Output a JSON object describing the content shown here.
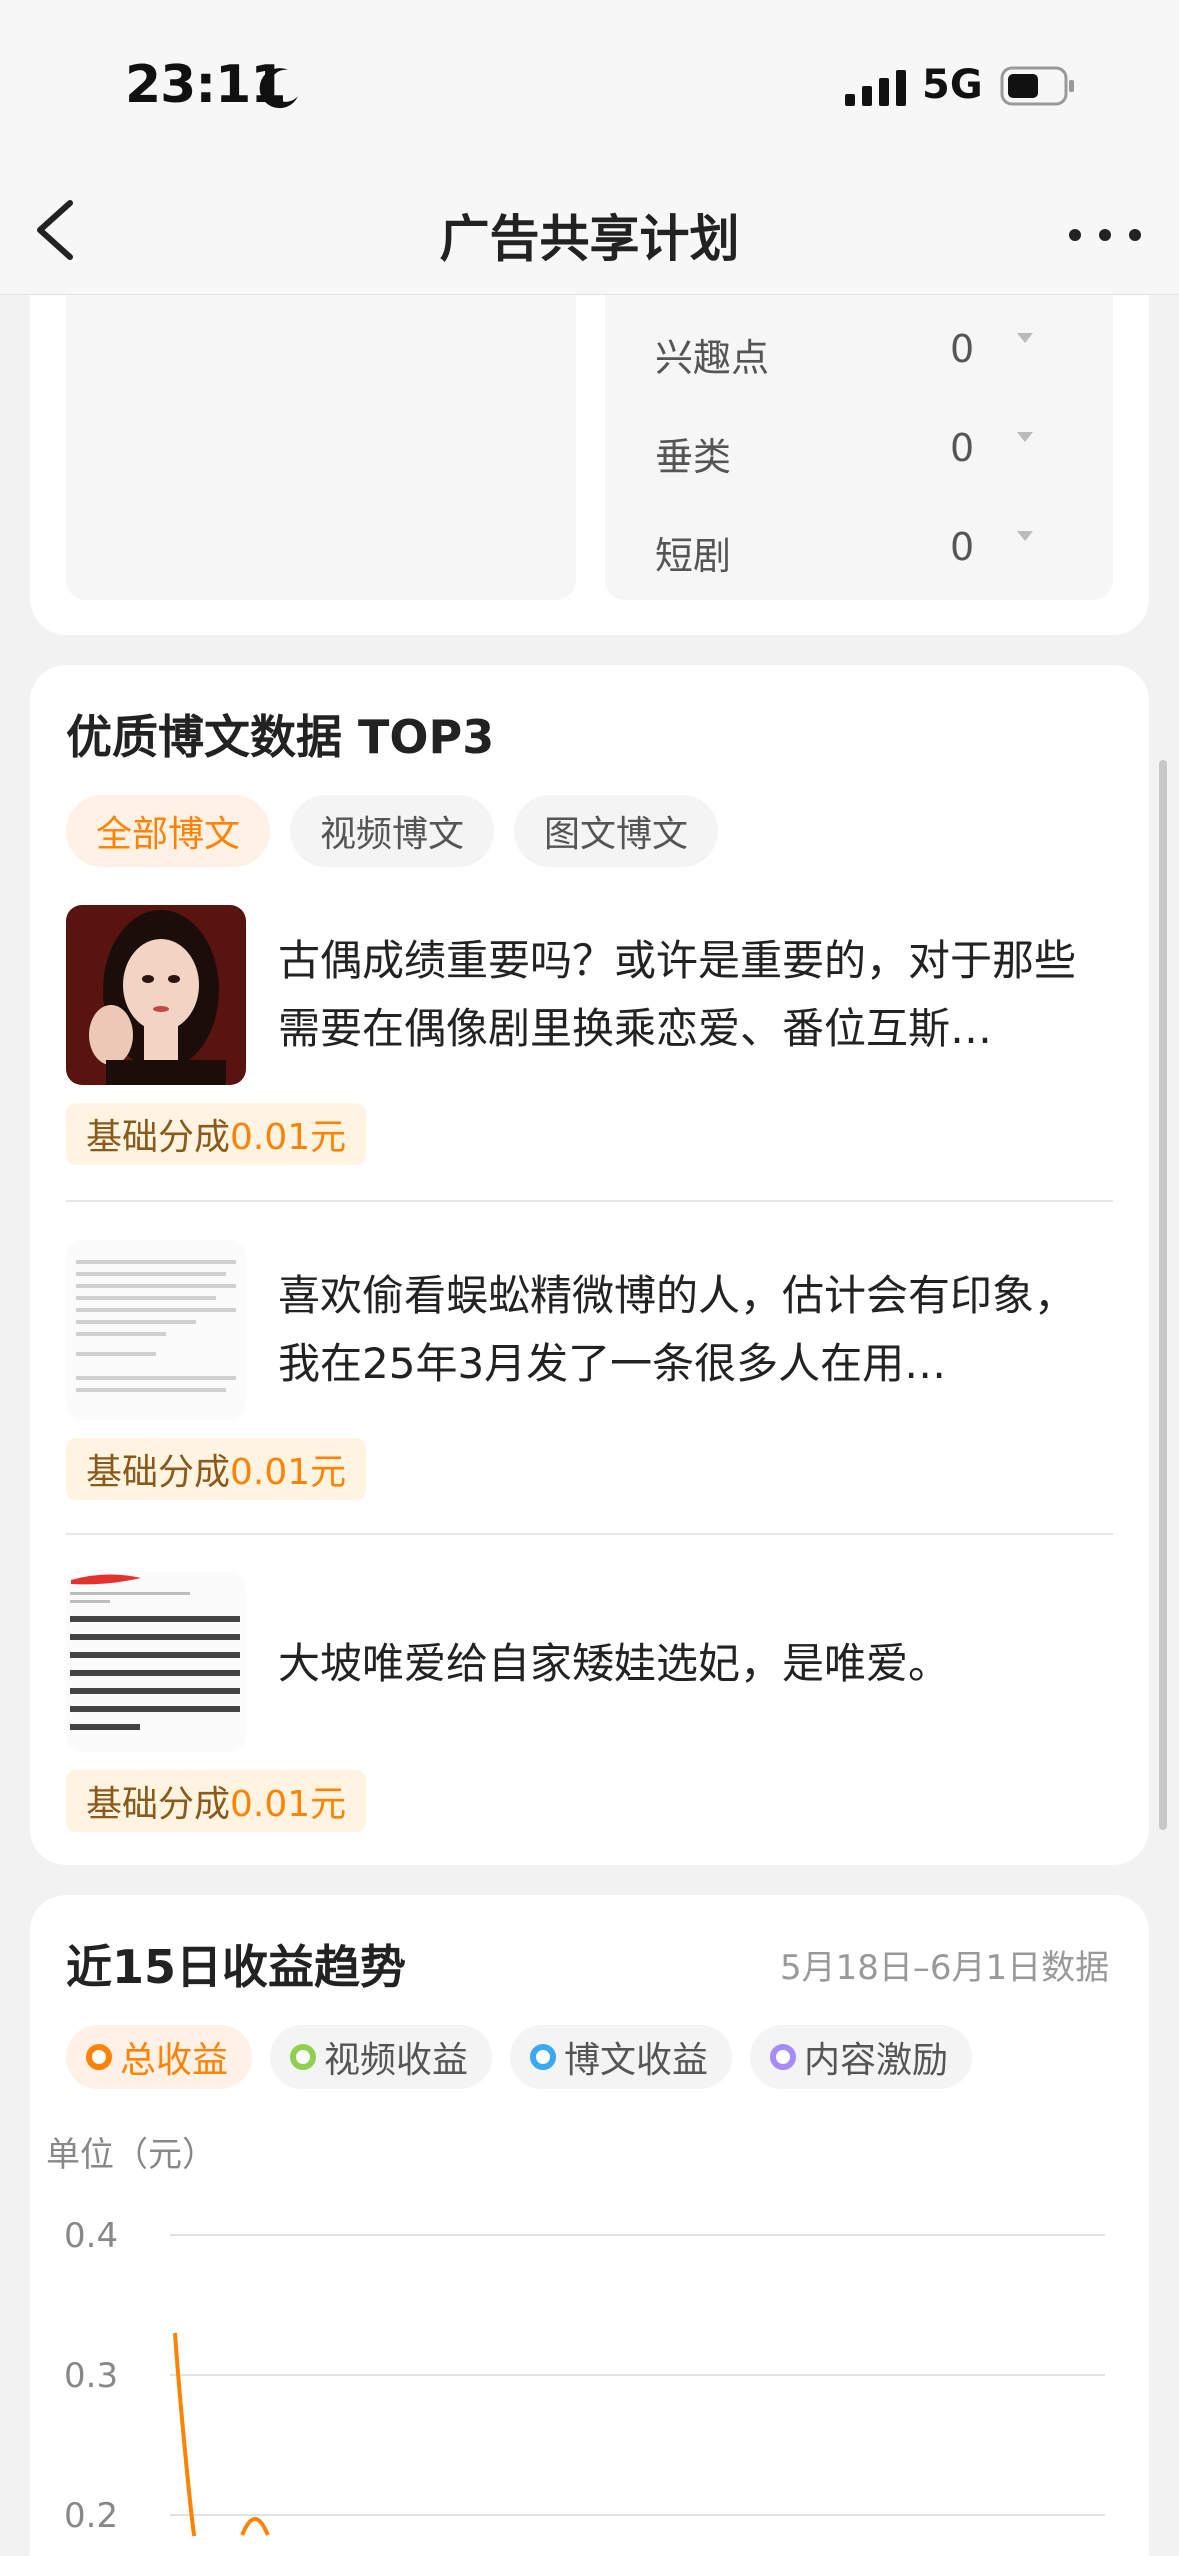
{
  "status_bar": {
    "time": "23:11",
    "network": "5G"
  },
  "nav": {
    "title": "广告共享计划"
  },
  "filters": [
    {
      "label": "兴趣点",
      "value": "0"
    },
    {
      "label": "垂类",
      "value": "0"
    },
    {
      "label": "短剧",
      "value": "0"
    }
  ],
  "top3": {
    "title": "优质博文数据 TOP3",
    "tabs": [
      "全部博文",
      "视频博文",
      "图文博文"
    ],
    "posts": [
      {
        "text": "古偶成绩重要吗？或许是重要的，对于那些需要在偶像剧里换乘恋爱、番位互斯…",
        "badge_label": "基础分成",
        "badge_amount": "0.01元"
      },
      {
        "text": "喜欢偷看蜈蚣精微博的人，估计会有印象，我在25年3月发了一条很多人在用…",
        "badge_label": "基础分成",
        "badge_amount": "0.01元"
      },
      {
        "text": "大坡唯爱给自家矮娃选妃，是唯爱。",
        "badge_label": "基础分成",
        "badge_amount": "0.01元"
      }
    ]
  },
  "trend": {
    "title": "近15日收益趋势",
    "date_range": "5月18日–6月1日数据",
    "legend": [
      {
        "label": "总收益",
        "color": "#ff8200"
      },
      {
        "label": "视频收益",
        "color": "#8fd14f"
      },
      {
        "label": "博文收益",
        "color": "#3aa8f5"
      },
      {
        "label": "内容激励",
        "color": "#a78bfa"
      }
    ],
    "unit_label": "单位（元）"
  },
  "chart_data": {
    "type": "line",
    "ylabel": "单位（元）",
    "y_ticks": [
      "0.4",
      "0.3",
      "0.2"
    ],
    "ylim": [
      0.2,
      0.4
    ],
    "series": [
      {
        "name": "总收益",
        "color": "#ff8200",
        "x": [
          0,
          0.5,
          1,
          1.5
        ],
        "values": [
          0.33,
          0.2,
          0.2,
          0.2
        ]
      }
    ]
  }
}
